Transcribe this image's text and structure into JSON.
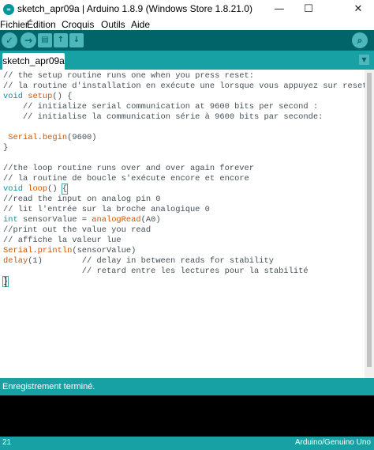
{
  "window": {
    "title": "sketch_apr09a | Arduino 1.8.9 (Windows Store 1.8.21.0)",
    "logo_icon": "arduino-logo-icon",
    "minimize_symbol": "—",
    "maximize_symbol": "☐",
    "close_symbol": "✕"
  },
  "menu": [
    "Fichier",
    "Édition",
    "Croquis",
    "Outils",
    "Aide"
  ],
  "toolbar": {
    "verify_icon": "✓",
    "upload_icon": "→",
    "new_icon": "▤",
    "open_icon": "↑",
    "save_icon": "↓",
    "serial_monitor_icon": "⌕"
  },
  "tabs": [
    {
      "label": "sketch_apr09a"
    }
  ],
  "tab_menu_icon": "▼",
  "code": {
    "l1": "// the setup routine runs one when you press reset:",
    "l2": "// la routine d'installation en exécute une lorsque vous appuyez sur reset:",
    "l3_kw": "void",
    "l3_fn": "setup",
    "l3_rest": "() {",
    "l4": "    // initialize serial communication at 9600 bits per second :",
    "l5": "    // initialise la communication série à 9600 bits par seconde:",
    "l7_kw": "Serial",
    "l7_dot": ".",
    "l7_fn": "begin",
    "l7_rest": "(9600)",
    "l8": "}",
    "l10": "//the loop routine runs over and over again forever",
    "l11": "// la routine de boucle s'exécute encore et encore",
    "l12_kw": "void",
    "l12_fn": "loop",
    "l12_rest": "() ",
    "l12_brace": "{",
    "l13": "//read the input on analog pin 0",
    "l14": "// lit l'entrée sur la broche analogique 0",
    "l15_kw": "int",
    "l15_mid": " sensorValue = ",
    "l15_fn": "analogRead",
    "l15_rest": "(A0)",
    "l16": "//print out the value you read",
    "l17": "// affiche la valeur lue",
    "l18_kw": "Serial",
    "l18_dot": ".",
    "l18_fn": "println",
    "l18_rest": "(sensorValue)",
    "l19_fn": "delay",
    "l19_rest": "(1)        // delay in between reads for stability",
    "l20": "                // retard entre les lectures pour la stabilité",
    "l21": "}"
  },
  "status": {
    "message": "Enregistrement terminé."
  },
  "footer": {
    "line": "21",
    "board": "Arduino/Genuino Uno"
  },
  "colors": {
    "toolbar": "#006468",
    "tabbar": "#17a1a5",
    "keyword": "#00979c",
    "function": "#d35400"
  }
}
